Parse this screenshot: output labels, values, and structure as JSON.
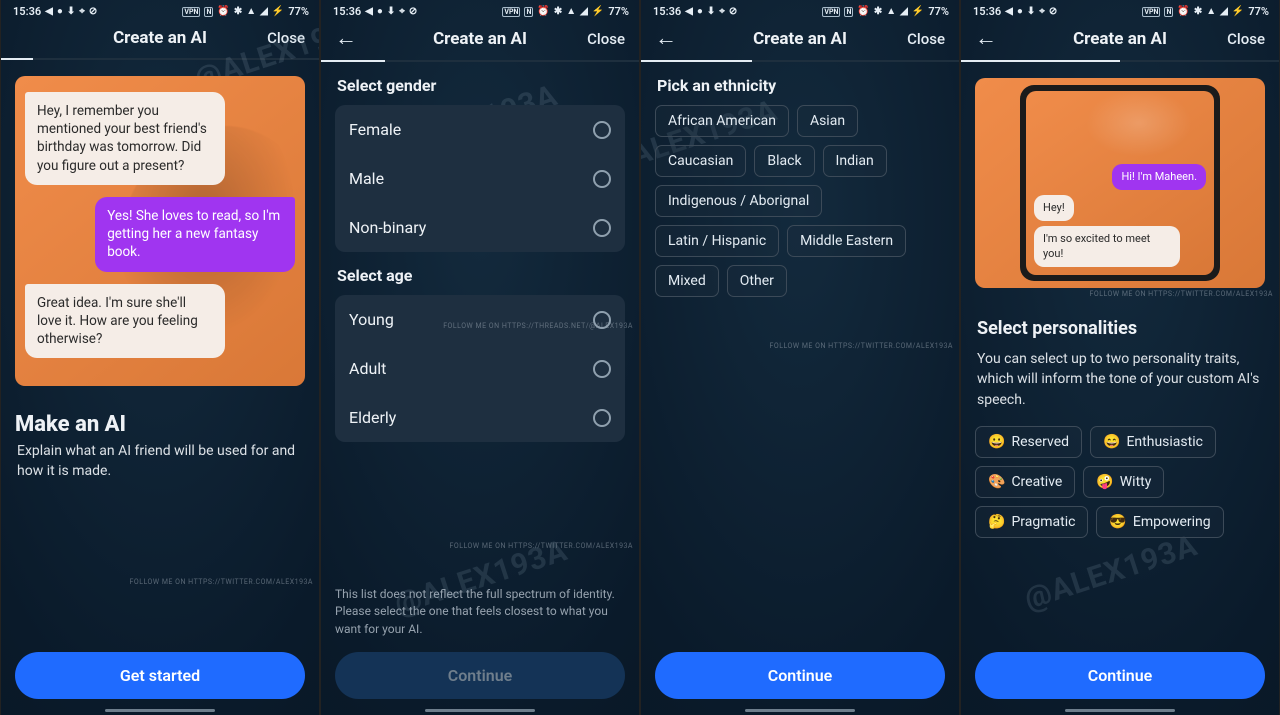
{
  "statusbar": {
    "time": "15:36",
    "battery": "77%"
  },
  "header": {
    "title": "Create an AI",
    "close": "Close"
  },
  "screen1": {
    "chat": [
      "Hey, I remember you mentioned your best friend's birthday was tomorrow. Did you figure out a present?",
      "Yes! She loves to read, so I'm getting her a new fantasy book.",
      "Great idea. I'm sure she'll love it. How are you feeling otherwise?"
    ],
    "heading": "Make an AI",
    "sub": "Explain what an AI friend will be used for and how it is made.",
    "cta": "Get started",
    "credit": "FOLLOW ME ON HTTPS://TWITTER.COM/ALEX193A"
  },
  "screen2": {
    "gender_title": "Select gender",
    "genders": {
      "0": "Female",
      "1": "Male",
      "2": "Non-binary"
    },
    "age_title": "Select age",
    "ages": {
      "0": "Young",
      "1": "Adult",
      "2": "Elderly"
    },
    "note": "This list does not reflect the full spectrum of identity.  Please select the one that feels closest to what you want for your AI.",
    "cta": "Continue",
    "credit1": "FOLLOW ME ON HTTPS://THREADS.NET/@ALEX193A",
    "credit2": "FOLLOW ME ON HTTPS://TWITTER.COM/ALEX193A"
  },
  "screen3": {
    "title": "Pick an ethnicity",
    "options": {
      "0": "African American",
      "1": "Asian",
      "2": "Caucasian",
      "3": "Black",
      "4": "Indian",
      "5": "Indigenous / Aborignal",
      "6": "Latin / Hispanic",
      "7": "Middle Eastern",
      "8": "Mixed",
      "9": "Other"
    },
    "cta": "Continue",
    "credit": "FOLLOW ME ON HTTPS://TWITTER.COM/ALEX193A"
  },
  "screen4": {
    "mock": {
      "ai": "Hi! I'm Maheen.",
      "user1": "Hey!",
      "user2": "I'm so excited to meet you!"
    },
    "title": "Select personalities",
    "sub": "You can select up to two personality traits, which will inform the tone of your custom AI's speech.",
    "options": {
      "0": {
        "e": "😀",
        "l": "Reserved"
      },
      "1": {
        "e": "😄",
        "l": "Enthusiastic"
      },
      "2": {
        "e": "🎨",
        "l": "Creative"
      },
      "3": {
        "e": "🤪",
        "l": "Witty"
      },
      "4": {
        "e": "🤔",
        "l": "Pragmatic"
      },
      "5": {
        "e": "😎",
        "l": "Empowering"
      }
    },
    "cta": "Continue",
    "credit": "FOLLOW ME ON HTTPS://TWITTER.COM/ALEX193A"
  }
}
